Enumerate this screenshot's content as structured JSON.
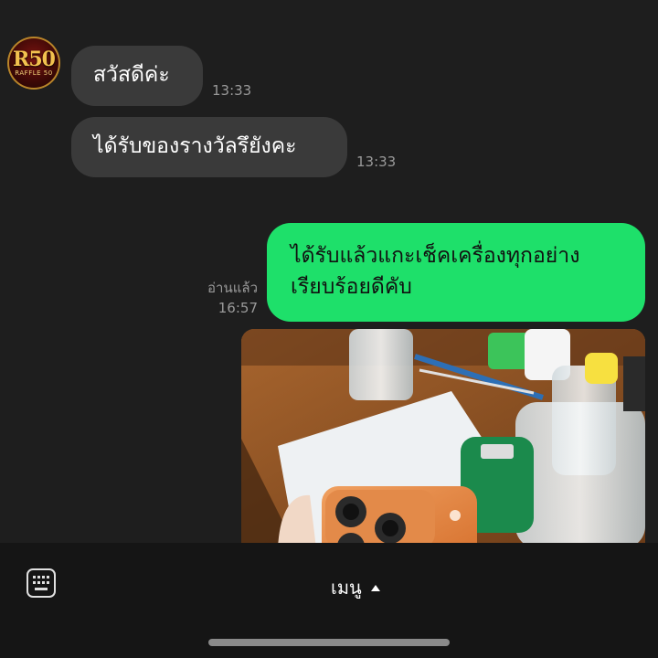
{
  "contact": {
    "avatar_label": "R50",
    "avatar_sub": "RAFFLE 50"
  },
  "messages": {
    "incoming": [
      {
        "text": "สวัสดีค่ะ",
        "time": "13:33"
      },
      {
        "text": "ได้รับของรางวัลรึยังคะ",
        "time": "13:33"
      }
    ],
    "outgoing": {
      "lines": [
        "ได้รับแล้วแกะเช็คเครื่องทุกอย่าง",
        "เรียบร้อยดีคับ"
      ],
      "status": "อ่านแล้ว",
      "time": "16:57"
    }
  },
  "bottom_bar": {
    "menu_label": "เมนู",
    "keyboard_icon": "keyboard-icon",
    "caret_icon": "caret-up-icon"
  },
  "colors": {
    "background": "#1e1e1e",
    "incoming_bubble": "#3a3a3a",
    "outgoing_bubble": "#1ee06a"
  }
}
